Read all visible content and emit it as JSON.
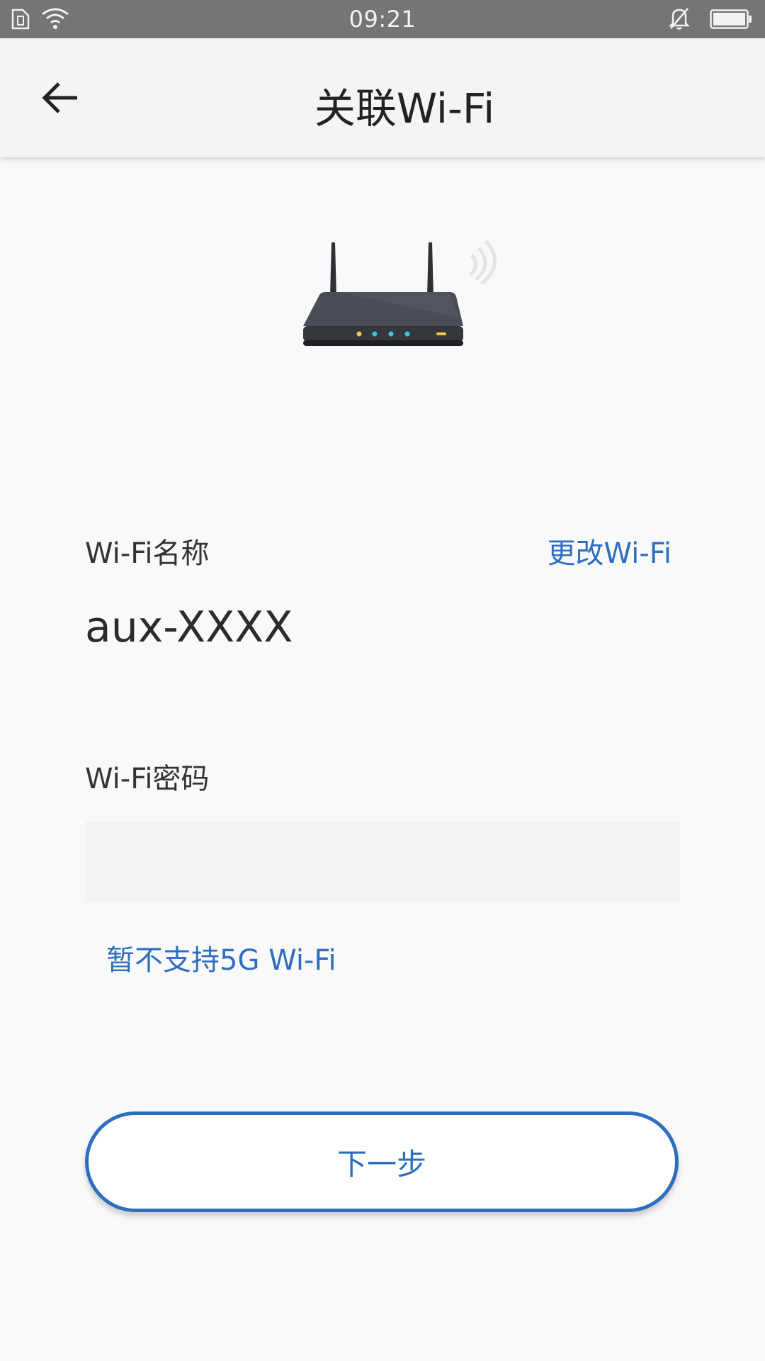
{
  "status_bar": {
    "time": "09:21",
    "icons": [
      "sim-icon",
      "wifi-icon",
      "bell-muted-icon",
      "battery-icon"
    ]
  },
  "header": {
    "back_icon": "arrow-left-icon",
    "title": "关联Wi-Fi"
  },
  "illustration": {
    "icon": "router-icon"
  },
  "form": {
    "wifi_name_label": "Wi-Fi名称",
    "change_wifi_label": "更改Wi-Fi",
    "wifi_name_value": "aux-XXXX",
    "wifi_password_label": "Wi-Fi密码",
    "wifi_password_value": "",
    "note_5g": "暂不支持5G Wi-Fi"
  },
  "actions": {
    "next_label": "下一步"
  },
  "colors": {
    "accent": "#2d6fbe",
    "status_bar": "#757575",
    "background": "#f9f9f9"
  }
}
